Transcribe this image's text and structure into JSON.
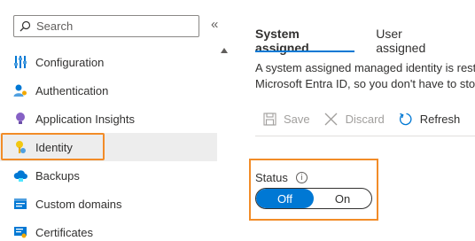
{
  "sidebar": {
    "search_placeholder": "Search",
    "collapse_glyph": "«",
    "items": [
      {
        "label": "Configuration",
        "icon": "configuration-icon"
      },
      {
        "label": "Authentication",
        "icon": "authentication-icon"
      },
      {
        "label": "Application Insights",
        "icon": "application-insights-icon"
      },
      {
        "label": "Identity",
        "icon": "identity-icon",
        "active": true
      },
      {
        "label": "Backups",
        "icon": "backups-icon"
      },
      {
        "label": "Custom domains",
        "icon": "custom-domains-icon"
      },
      {
        "label": "Certificates",
        "icon": "certificates-icon"
      }
    ]
  },
  "main": {
    "tabs": [
      {
        "label": "System assigned",
        "selected": true
      },
      {
        "label": "User assigned",
        "selected": false
      }
    ],
    "description_line1": "A system assigned managed identity is rest",
    "description_line2": "Microsoft Entra ID, so you don't have to sto",
    "toolbar": {
      "save": "Save",
      "discard": "Discard",
      "refresh": "Refresh"
    },
    "status": {
      "label": "Status",
      "info_glyph": "i",
      "off_label": "Off",
      "on_label": "On",
      "value": "Off"
    }
  },
  "colors": {
    "accent": "#0078d4",
    "highlight": "#f28c28"
  }
}
